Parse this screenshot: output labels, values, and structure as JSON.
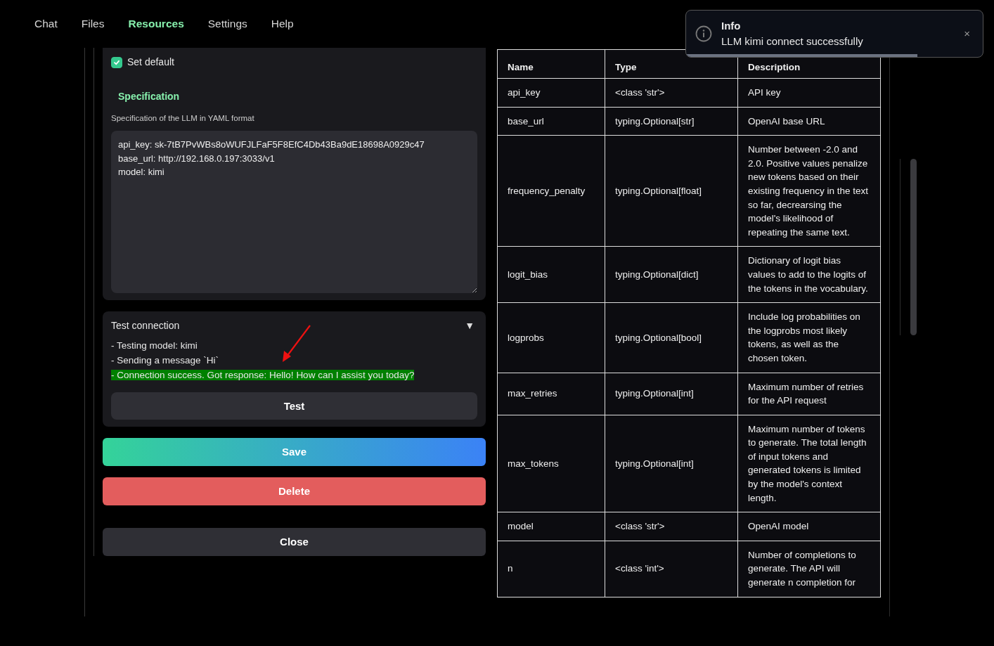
{
  "nav": [
    {
      "label": "Chat",
      "selected": false
    },
    {
      "label": "Files",
      "selected": false
    },
    {
      "label": "Resources",
      "selected": true
    },
    {
      "label": "Settings",
      "selected": false
    },
    {
      "label": "Help",
      "selected": false
    }
  ],
  "form": {
    "set_default": {
      "label": "Set default",
      "checked": true
    },
    "spec_title": "Specification",
    "spec_hint": "Specification of the LLM in YAML format",
    "spec_value": "api_key: sk-7tB7PvWBs8oWUFJLFaF5F8EfC4Db43Ba9dE18698A0929c47\nbase_url: http://192.168.0.197:3033/v1\nmodel: kimi"
  },
  "test": {
    "title": "Test connection",
    "toggle": "▼",
    "log": [
      {
        "text": "- Testing model: kimi",
        "kind": "info"
      },
      {
        "text": "- Sending a message `Hi`",
        "kind": "info"
      },
      {
        "text": "- Connection success. Got response: Hello! How can I assist you today?",
        "kind": "success"
      }
    ],
    "button": "Test"
  },
  "buttons": [
    {
      "label": "Save",
      "kind": "primary"
    },
    {
      "label": "Delete",
      "kind": "danger"
    },
    {
      "label": "Close",
      "kind": "secondary"
    }
  ],
  "table": {
    "columns": [
      "Name",
      "Type",
      "Description"
    ],
    "rows": [
      [
        "api_key",
        "<class 'str'>",
        "API key"
      ],
      [
        "base_url",
        "typing.Optional[str]",
        "OpenAI base URL"
      ],
      [
        "frequency_penalty",
        "typing.Optional[float]",
        "Number between -2.0 and 2.0. Positive values penalize new tokens based on their existing frequency in the text so far, decrearsing the model's likelihood of repeating the same text."
      ],
      [
        "logit_bias",
        "typing.Optional[dict]",
        "Dictionary of logit bias values to add to the logits of the tokens in the vocabulary."
      ],
      [
        "logprobs",
        "typing.Optional[bool]",
        "Include log probabilities on the logprobs most likely tokens, as well as the chosen token."
      ],
      [
        "max_retries",
        "typing.Optional[int]",
        "Maximum number of retries for the API request"
      ],
      [
        "max_tokens",
        "typing.Optional[int]",
        "Maximum number of tokens to generate. The total length of input tokens and generated tokens is limited by the model's context length."
      ],
      [
        "model",
        "<class 'str'>",
        "OpenAI model"
      ],
      [
        "n",
        "<class 'int'>",
        "Number of completions to generate. The API will generate n completion for"
      ]
    ]
  },
  "toast": {
    "title": "Info",
    "message": "LLM kimi connect successfully",
    "close": "×",
    "level": 0.78
  }
}
